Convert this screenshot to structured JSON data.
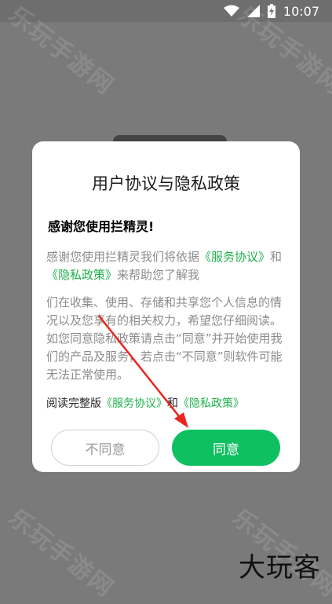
{
  "status_bar": {
    "time": "10:07"
  },
  "watermark": {
    "text": "乐玩手游网"
  },
  "dialog": {
    "title": "用户协议与隐私政策",
    "greeting": "感谢您使用拦精灵!",
    "paragraph1": {
      "before": "感谢您使用拦精灵我们将依据",
      "link1": "《服务协议》",
      "and": "和",
      "link2": "《隐私政策》",
      "after": "来帮助您了解我"
    },
    "paragraph2": "们在收集、使用、存储和共享您个人信息的情况以及您享有的相关权力，希望您仔细阅读。如您同意隐私政策请点击“同意”并开始使用我们的产品及服务，若点击“不同意”则软件可能无法正常使用。",
    "read_line": {
      "prefix": "阅读完整版",
      "link1": "《服务协议》",
      "and": "和",
      "link2": "《隐私政策》"
    },
    "decline_label": "不同意",
    "agree_label": "同意"
  },
  "brand": {
    "text": "大玩客"
  },
  "colors": {
    "accent": "#0fc060",
    "link": "#1fb14c",
    "arrow": "#e8261f"
  }
}
